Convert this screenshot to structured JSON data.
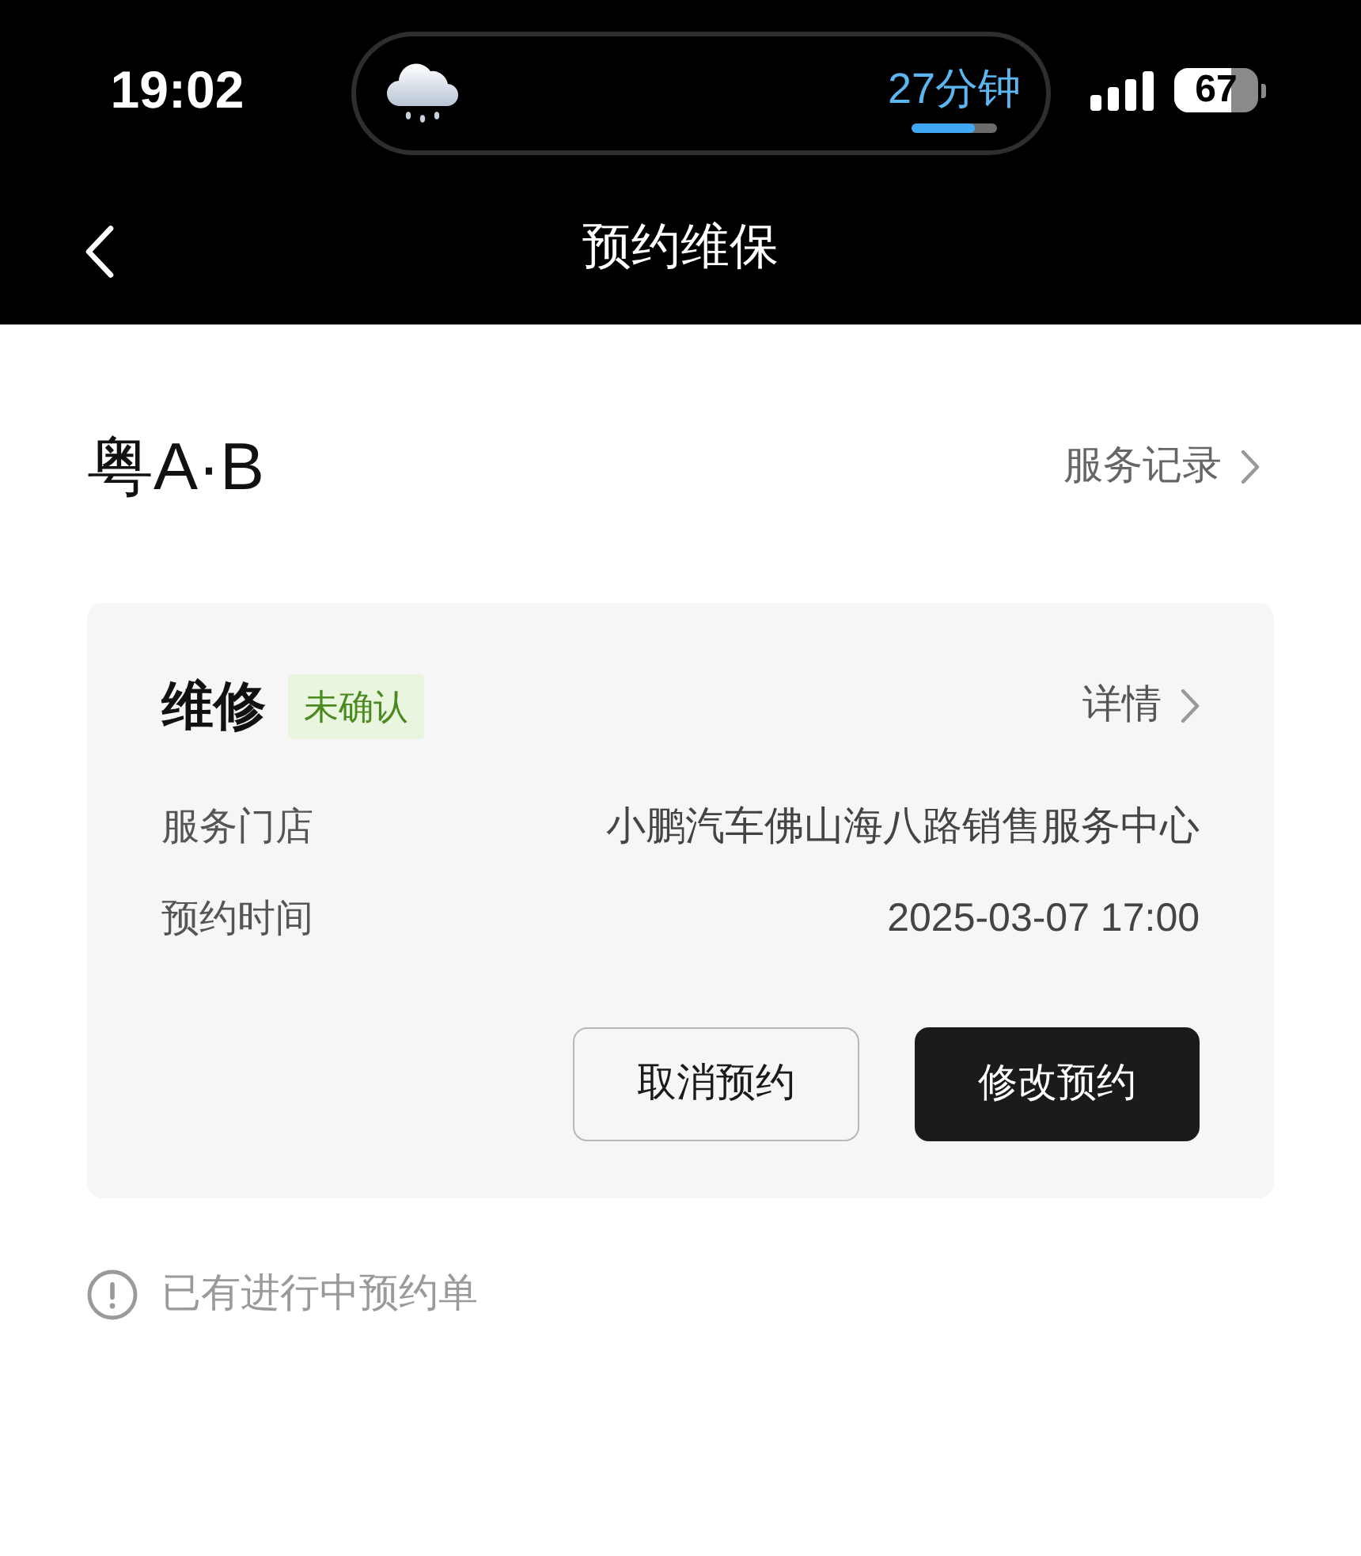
{
  "status_bar": {
    "time": "19:02",
    "activity": {
      "text": "27分钟",
      "level": 0.75
    },
    "battery": {
      "text": "67",
      "level": 0.67
    }
  },
  "nav": {
    "title": "预约维保"
  },
  "vehicle": {
    "plate": "粤A·B",
    "link": "服务记录"
  },
  "appointment": {
    "type": "维修",
    "status": "未确认",
    "detail_link": "详情",
    "fields": [
      {
        "label": "服务门店",
        "value": "小鹏汽车佛山海八路销售服务中心"
      },
      {
        "label": "预约时间",
        "value": "2025-03-07 17:00"
      }
    ],
    "buttons": [
      {
        "label": "取消预约",
        "kind": "secondary"
      },
      {
        "label": "修改预约",
        "kind": "primary"
      }
    ]
  },
  "notice": "已有进行中预约单"
}
